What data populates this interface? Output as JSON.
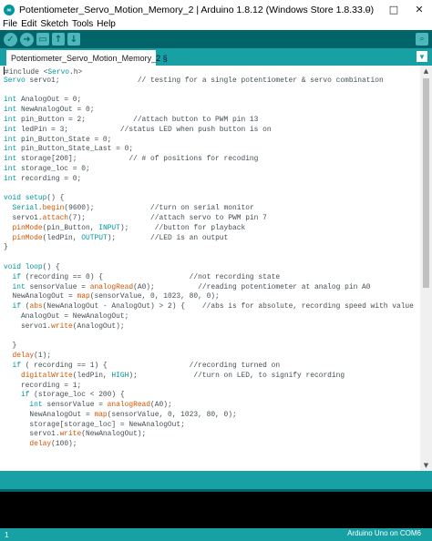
{
  "window": {
    "title": "Potentiometer_Servo_Motion_Memory_2 | Arduino 1.8.12 (Windows Store 1.8.33.0)",
    "logo_icon": "arduino-logo-icon",
    "controls": {
      "minimize": "–",
      "maximize": "□",
      "close": "✕"
    }
  },
  "menu": [
    "File",
    "Edit",
    "Sketch",
    "Tools",
    "Help"
  ],
  "toolbar": {
    "buttons": [
      {
        "name": "verify",
        "icon": "check-icon",
        "glyph": "✓"
      },
      {
        "name": "upload",
        "icon": "arrow-right-icon",
        "glyph": "➜"
      },
      {
        "name": "new",
        "icon": "new-file-icon",
        "glyph": "▭"
      },
      {
        "name": "open",
        "icon": "arrow-up-icon",
        "glyph": "↑"
      },
      {
        "name": "save",
        "icon": "arrow-down-icon",
        "glyph": "↓"
      }
    ],
    "serial_monitor_glyph": "⌕"
  },
  "tabs": [
    {
      "label": "Potentiometer_Servo_Motion_Memory_2 §"
    }
  ],
  "tab_menu_glyph": "▼",
  "code_lines": [
    [
      [
        "pp",
        "#include <"
      ],
      [
        "kw",
        "Servo"
      ],
      [
        "pp",
        ".h>"
      ]
    ],
    [
      [
        "kw",
        "Servo"
      ],
      [
        "t",
        " servo1;                  "
      ],
      [
        "cm",
        "// testing for a single potentiometer & servo combination"
      ]
    ],
    [
      [
        "t",
        ""
      ]
    ],
    [
      [
        "kw",
        "int"
      ],
      [
        "t",
        " AnalogOut = 0;"
      ]
    ],
    [
      [
        "kw",
        "int"
      ],
      [
        "t",
        " NewAnalogOut = 0;"
      ]
    ],
    [
      [
        "kw",
        "int"
      ],
      [
        "t",
        " pin_Button = 2;           "
      ],
      [
        "cm",
        "//attach button to PWM pin 13"
      ]
    ],
    [
      [
        "kw",
        "int"
      ],
      [
        "t",
        " ledPin = 3;            "
      ],
      [
        "cm",
        "//status LED when push button is on"
      ]
    ],
    [
      [
        "kw",
        "int"
      ],
      [
        "t",
        " pin_Button_State = 0;"
      ]
    ],
    [
      [
        "kw",
        "int"
      ],
      [
        "t",
        " pin_Button_State_Last = 0;"
      ]
    ],
    [
      [
        "kw",
        "int"
      ],
      [
        "t",
        " storage[200];            "
      ],
      [
        "cm",
        "// # of positions for recoding"
      ]
    ],
    [
      [
        "kw",
        "int"
      ],
      [
        "t",
        " storage_loc = 0;"
      ]
    ],
    [
      [
        "kw",
        "int"
      ],
      [
        "t",
        " recording = 0;"
      ]
    ],
    [
      [
        "t",
        ""
      ]
    ],
    [
      [
        "kw",
        "void"
      ],
      [
        "t",
        " "
      ],
      [
        "kw",
        "setup"
      ],
      [
        "t",
        "() {"
      ]
    ],
    [
      [
        "t",
        "  "
      ],
      [
        "kw",
        "Serial"
      ],
      [
        "t",
        "."
      ],
      [
        "fn",
        "begin"
      ],
      [
        "t",
        "(9600);             "
      ],
      [
        "cm",
        "//turn on serial monitor"
      ]
    ],
    [
      [
        "t",
        "  servo1."
      ],
      [
        "fn",
        "attach"
      ],
      [
        "t",
        "(7);               "
      ],
      [
        "cm",
        "//attach servo to PWM pin 7"
      ]
    ],
    [
      [
        "t",
        "  "
      ],
      [
        "fn",
        "pinMode"
      ],
      [
        "t",
        "(pin_Button, "
      ],
      [
        "kw",
        "INPUT"
      ],
      [
        "t",
        ");      "
      ],
      [
        "cm",
        "//button for playback"
      ]
    ],
    [
      [
        "t",
        "  "
      ],
      [
        "fn",
        "pinMode"
      ],
      [
        "t",
        "(ledPin, "
      ],
      [
        "kw",
        "OUTPUT"
      ],
      [
        "t",
        ");        "
      ],
      [
        "cm",
        "//LED is an output"
      ]
    ],
    [
      [
        "t",
        "}"
      ]
    ],
    [
      [
        "t",
        ""
      ]
    ],
    [
      [
        "kw",
        "void"
      ],
      [
        "t",
        " "
      ],
      [
        "kw",
        "loop"
      ],
      [
        "t",
        "() {"
      ]
    ],
    [
      [
        "t",
        "  "
      ],
      [
        "kw",
        "if"
      ],
      [
        "t",
        " (recording == 0) {                    "
      ],
      [
        "cm",
        "//not recording state"
      ]
    ],
    [
      [
        "t",
        "  "
      ],
      [
        "kw",
        "int"
      ],
      [
        "t",
        " sensorValue = "
      ],
      [
        "fn",
        "analogRead"
      ],
      [
        "t",
        "(A0);          "
      ],
      [
        "cm",
        "//reading potentiometer at analog pin A0"
      ]
    ],
    [
      [
        "t",
        "  NewAnalogOut = "
      ],
      [
        "fn",
        "map"
      ],
      [
        "t",
        "(sensorValue, 0, 1023, 80, 0);"
      ]
    ],
    [
      [
        "t",
        "  "
      ],
      [
        "kw",
        "if"
      ],
      [
        "t",
        " ("
      ],
      [
        "fn",
        "abs"
      ],
      [
        "t",
        "(NewAnalogOut - AnalogOut) > 2) {    "
      ],
      [
        "cm",
        "//abs is for absolute, recording speed with value"
      ]
    ],
    [
      [
        "t",
        "    AnalogOut = NewAnalogOut;"
      ]
    ],
    [
      [
        "t",
        "    servo1."
      ],
      [
        "fn",
        "write"
      ],
      [
        "t",
        "(AnalogOut);"
      ]
    ],
    [
      [
        "t",
        ""
      ]
    ],
    [
      [
        "t",
        "  }"
      ]
    ],
    [
      [
        "t",
        "  "
      ],
      [
        "fn",
        "delay"
      ],
      [
        "t",
        "(1);"
      ]
    ],
    [
      [
        "t",
        "  "
      ],
      [
        "kw",
        "if"
      ],
      [
        "t",
        " ( recording == 1) {                   "
      ],
      [
        "cm",
        "//recording turned on"
      ]
    ],
    [
      [
        "t",
        "    "
      ],
      [
        "fn",
        "digitalWrite"
      ],
      [
        "t",
        "(ledPin, "
      ],
      [
        "kw",
        "HIGH"
      ],
      [
        "t",
        ");             "
      ],
      [
        "cm",
        "//turn on LED, to signify recording"
      ]
    ],
    [
      [
        "t",
        "    recording = 1;"
      ]
    ],
    [
      [
        "t",
        "    "
      ],
      [
        "kw",
        "if"
      ],
      [
        "t",
        " (storage_loc < 200) {"
      ]
    ],
    [
      [
        "t",
        "      "
      ],
      [
        "kw",
        "int"
      ],
      [
        "t",
        " sensorValue = "
      ],
      [
        "fn",
        "analogRead"
      ],
      [
        "t",
        "(A0);"
      ]
    ],
    [
      [
        "t",
        "      NewAnalogOut = "
      ],
      [
        "fn",
        "map"
      ],
      [
        "t",
        "(sensorValue, 0, 1023, 80, 0);"
      ]
    ],
    [
      [
        "t",
        "      storage[storage_loc] = NewAnalogOut;"
      ]
    ],
    [
      [
        "t",
        "      servo1."
      ],
      [
        "fn",
        "write"
      ],
      [
        "t",
        "(NewAnalogOut);"
      ]
    ],
    [
      [
        "t",
        "      "
      ],
      [
        "fn",
        "delay"
      ],
      [
        "t",
        "(100);"
      ]
    ]
  ],
  "status": {
    "line_number": "1",
    "board": "Arduino Uno on COM6"
  },
  "scrollbar": {
    "up": "▲",
    "down": "▼"
  }
}
